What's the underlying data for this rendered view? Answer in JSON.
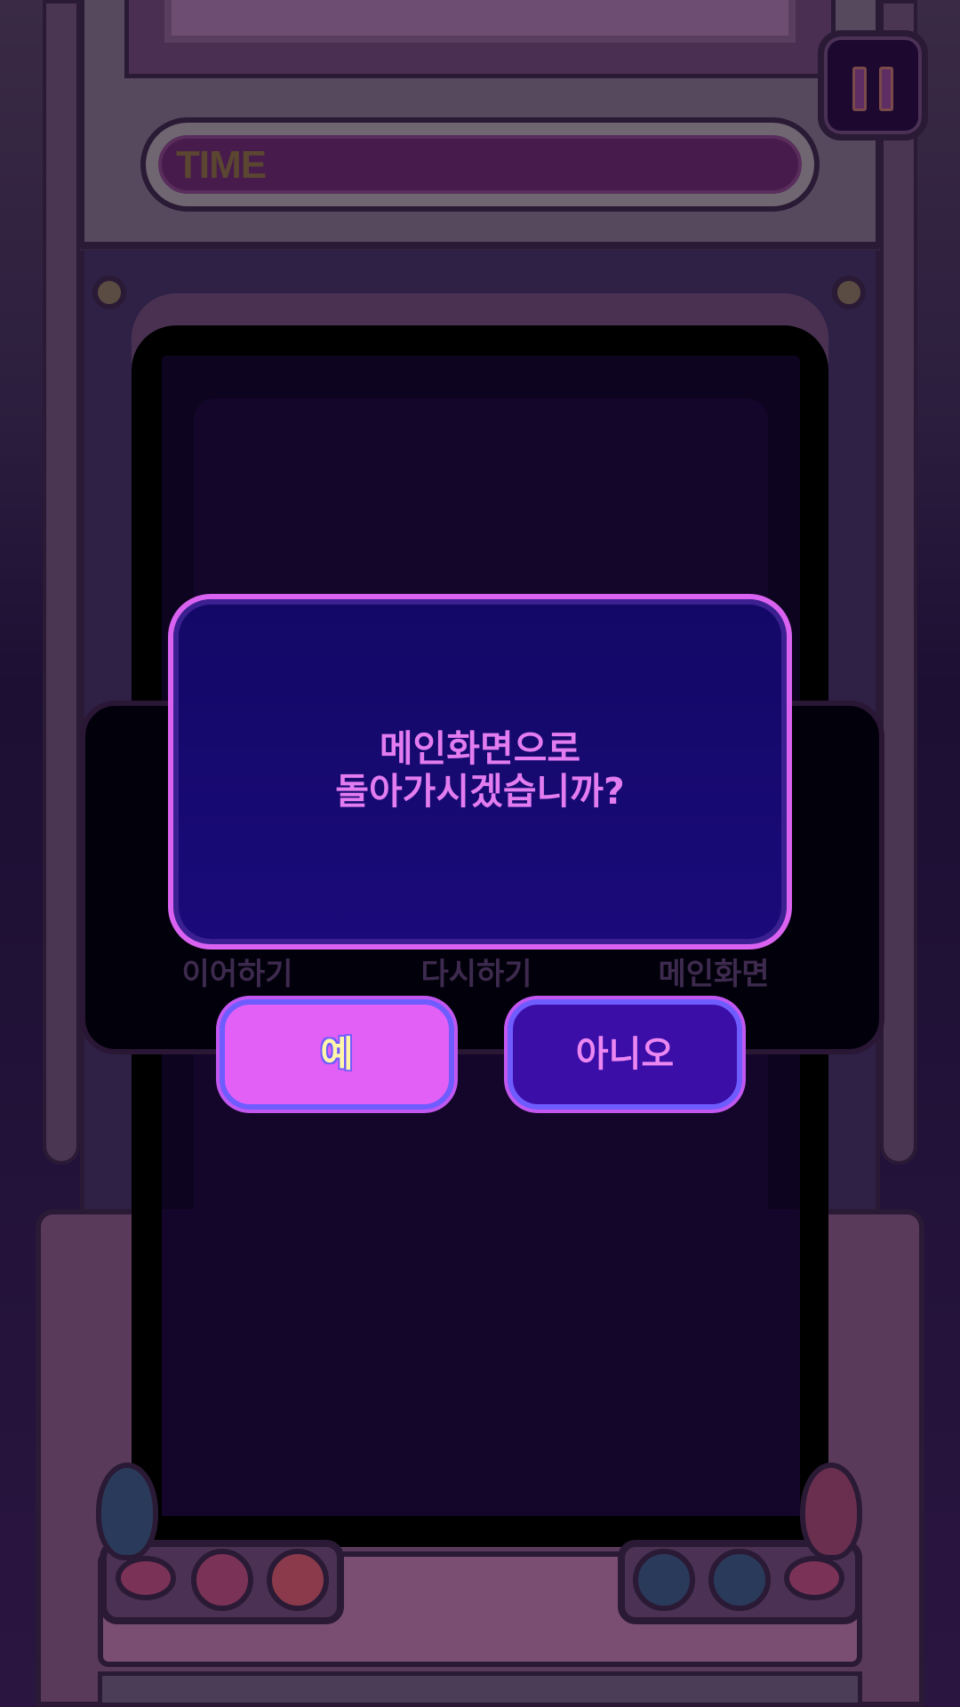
{
  "hud": {
    "time_label": "TIME"
  },
  "menu_behind": {
    "continue_label": "이어하기",
    "restart_label": "다시하기",
    "main_label": "메인화면"
  },
  "dialog": {
    "line1": "메인화면으로",
    "line2": "돌아가시겠습니까?",
    "yes_label": "예",
    "no_label": "아니오"
  },
  "colors": {
    "dialog_bg": "#130866",
    "dialog_border": "#d963f0",
    "yes_button": "#e260f5",
    "no_button": "#3b0ea8"
  },
  "icons": {
    "pause": "pause-icon"
  }
}
